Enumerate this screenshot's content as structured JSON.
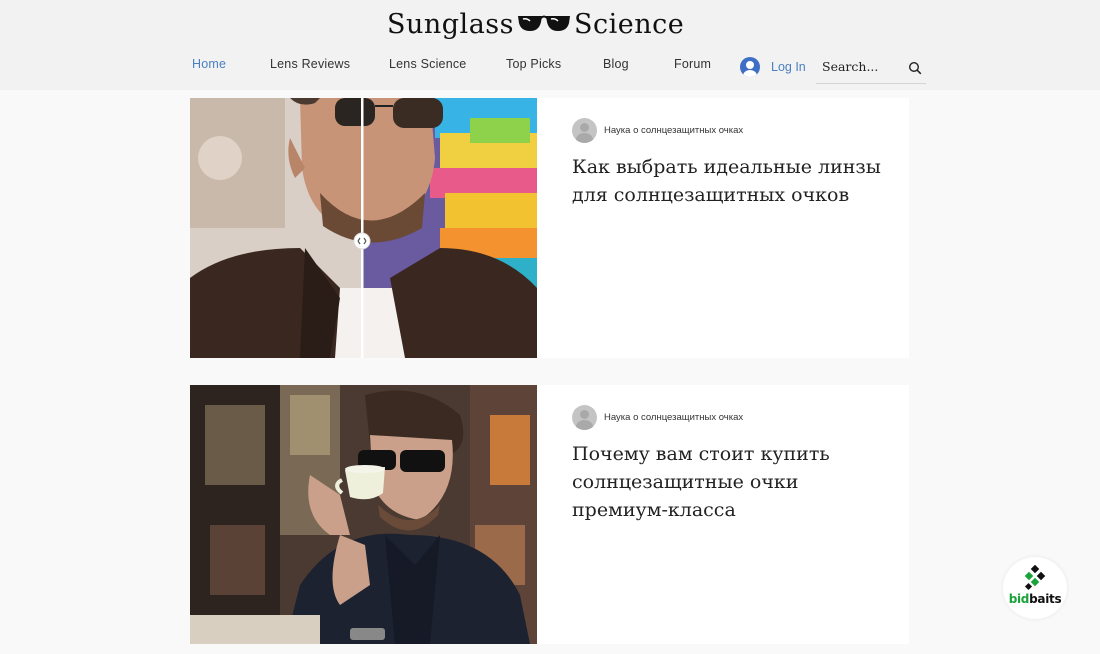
{
  "site": {
    "logo_left": "Sunglass",
    "logo_right": "Science"
  },
  "nav": {
    "items": [
      {
        "label": "Home",
        "active": true
      },
      {
        "label": "Lens Reviews",
        "active": false
      },
      {
        "label": "Lens Science",
        "active": false
      },
      {
        "label": "Top Picks",
        "active": false
      },
      {
        "label": "Blog",
        "active": false
      },
      {
        "label": "Forum",
        "active": false
      }
    ],
    "login_label": "Log In",
    "search_placeholder": "Search..."
  },
  "posts": [
    {
      "category": "Наука о солнцезащитных очках",
      "title": "Как выбрать идеальные линзы для солнцезащитных очков",
      "image": "comparison-slider-man-in-sunglasses"
    },
    {
      "category": "Наука о солнцезащитных очках",
      "title": "Почему вам стоит купить солнцезащитные очки премиум-класса",
      "image": "man-in-sunglasses-drinking-coffee"
    }
  ],
  "badge": {
    "part1": "bid",
    "part2": "baits"
  },
  "colors": {
    "accent": "#4a7fc1",
    "header_bg": "#f2f2f2",
    "page_bg": "#f9f9f9"
  }
}
